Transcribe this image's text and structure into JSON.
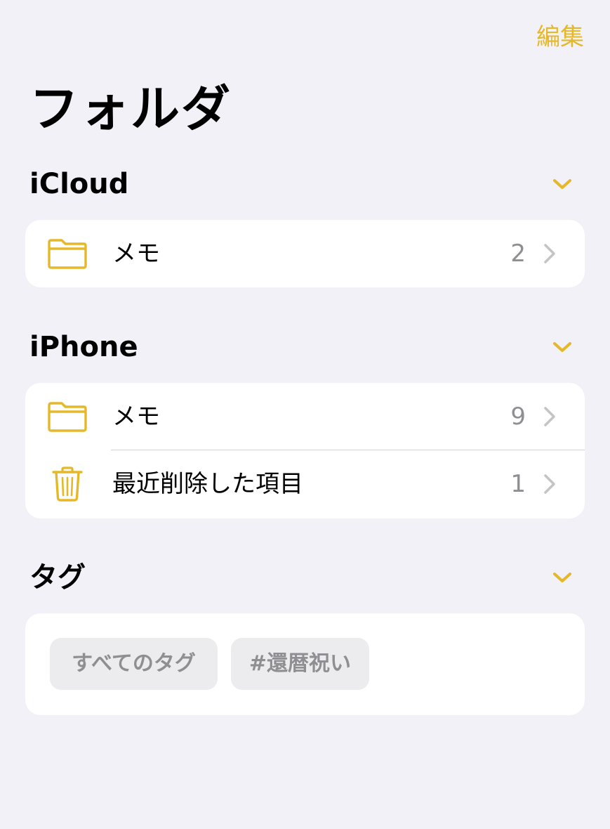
{
  "colors": {
    "accent": "#e5b82a",
    "background": "#f2f1f7",
    "card": "#ffffff",
    "secondary_text": "#8e8e93",
    "chip_background": "#ececee"
  },
  "navbar": {
    "edit_label": "編集"
  },
  "page": {
    "title": "フォルダ"
  },
  "sections": {
    "icloud": {
      "title": "iCloud",
      "toggle_icon": "chevron-down-icon",
      "rows": [
        {
          "icon": "folder-icon",
          "label": "メモ",
          "count": "2"
        }
      ]
    },
    "iphone": {
      "title": "iPhone",
      "toggle_icon": "chevron-down-icon",
      "rows": [
        {
          "icon": "folder-icon",
          "label": "メモ",
          "count": "9"
        },
        {
          "icon": "trash-icon",
          "label": "最近削除した項目",
          "count": "1"
        }
      ]
    },
    "tags": {
      "title": "タグ",
      "toggle_icon": "chevron-down-icon",
      "chips": [
        {
          "label": "すべてのタグ"
        },
        {
          "label": "#還暦祝い"
        }
      ]
    }
  }
}
